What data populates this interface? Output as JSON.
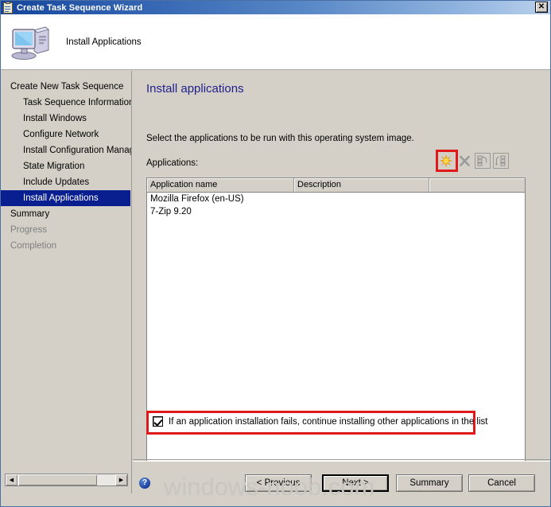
{
  "window": {
    "title": "Create Task Sequence Wizard",
    "title_icon": "task-sequence-clipboard-icon",
    "close_label": "✕",
    "accent_title_dark": "#14459b",
    "accent_title_light": "#b9d0ec",
    "selection_color": "#0a1f8f",
    "highlight_color": "#e01a1a"
  },
  "header": {
    "icon": "computer-icon",
    "title": "Install Applications"
  },
  "sidebar": {
    "items": [
      {
        "label": "Create New Task Sequence",
        "indent": false,
        "state": "normal"
      },
      {
        "label": "Task Sequence Information",
        "indent": true,
        "state": "normal"
      },
      {
        "label": "Install Windows",
        "indent": true,
        "state": "normal"
      },
      {
        "label": "Configure Network",
        "indent": true,
        "state": "normal"
      },
      {
        "label": "Install Configuration Manag",
        "indent": true,
        "state": "normal"
      },
      {
        "label": "State Migration",
        "indent": true,
        "state": "normal"
      },
      {
        "label": "Include Updates",
        "indent": true,
        "state": "normal"
      },
      {
        "label": "Install Applications",
        "indent": true,
        "state": "selected"
      },
      {
        "label": "Summary",
        "indent": false,
        "state": "normal"
      },
      {
        "label": "Progress",
        "indent": false,
        "state": "disabled"
      },
      {
        "label": "Completion",
        "indent": false,
        "state": "disabled"
      }
    ],
    "scrollbar": {
      "left_arrow": "◀",
      "right_arrow": "▶"
    }
  },
  "main": {
    "page_title": "Install applications",
    "instruction": "Select the applications to be run with this operating system image.",
    "applications_label": "Applications:",
    "toolbar": [
      {
        "name": "add-application-button",
        "icon": "yellow-star-icon",
        "enabled": true,
        "highlighted": true
      },
      {
        "name": "remove-application-button",
        "icon": "gray-x-icon",
        "enabled": false,
        "highlighted": false
      },
      {
        "name": "move-up-button",
        "icon": "move-up-icon",
        "enabled": false,
        "highlighted": false
      },
      {
        "name": "move-down-button",
        "icon": "move-down-icon",
        "enabled": false,
        "highlighted": false
      }
    ],
    "list": {
      "columns": [
        "Application name",
        "Description",
        ""
      ],
      "rows": [
        {
          "name": "Mozilla Firefox (en-US)",
          "description": ""
        },
        {
          "name": "7-Zip 9.20",
          "description": ""
        }
      ]
    },
    "checkbox": {
      "label": "If an application installation fails, continue installing other applications in the list",
      "checked": true
    }
  },
  "footer": {
    "help_icon": "help-question-icon",
    "help_glyph": "?",
    "previous_label": "< Previous",
    "next_label": "Next >",
    "summary_label": "Summary",
    "cancel_label": "Cancel"
  },
  "watermark": "windows-noob.com"
}
